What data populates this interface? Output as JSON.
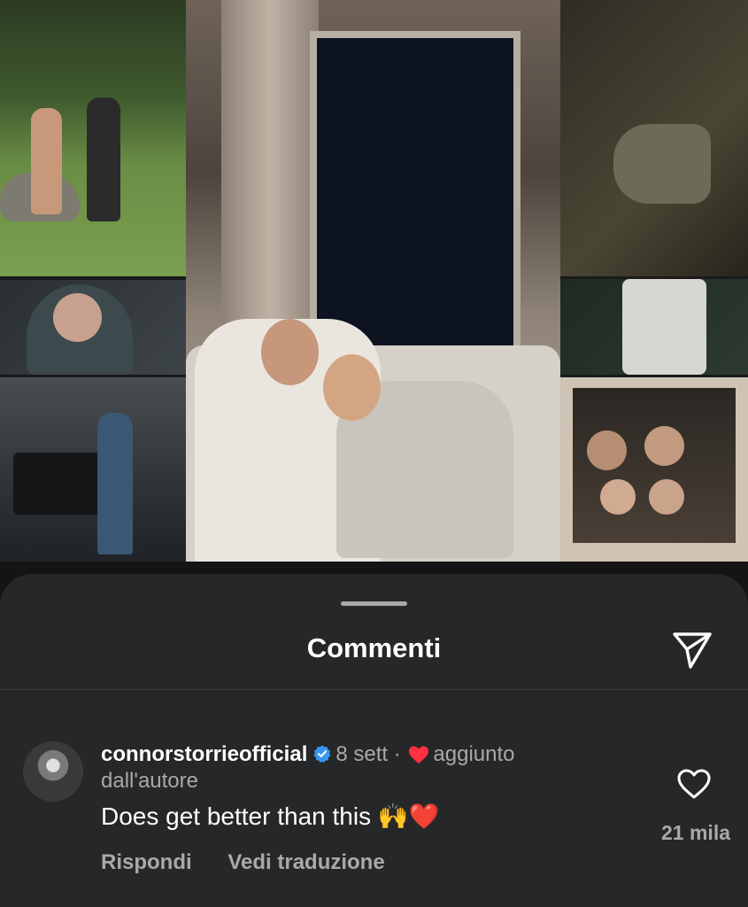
{
  "sheet": {
    "title": "Commenti"
  },
  "comment": {
    "username": "connorstorrieofficial",
    "time": "8 sett",
    "separator": "·",
    "added_by_author": "aggiunto dall'autore",
    "text": "Does get better than this 🙌❤️",
    "reply_label": "Rispondi",
    "translate_label": "Vedi traduzione",
    "like_count": "21 mila"
  },
  "colors": {
    "sheet_bg": "#262728",
    "secondary_text": "#a8a9ab",
    "verified_blue": "#3797f0",
    "heart_red": "#ff3040"
  }
}
